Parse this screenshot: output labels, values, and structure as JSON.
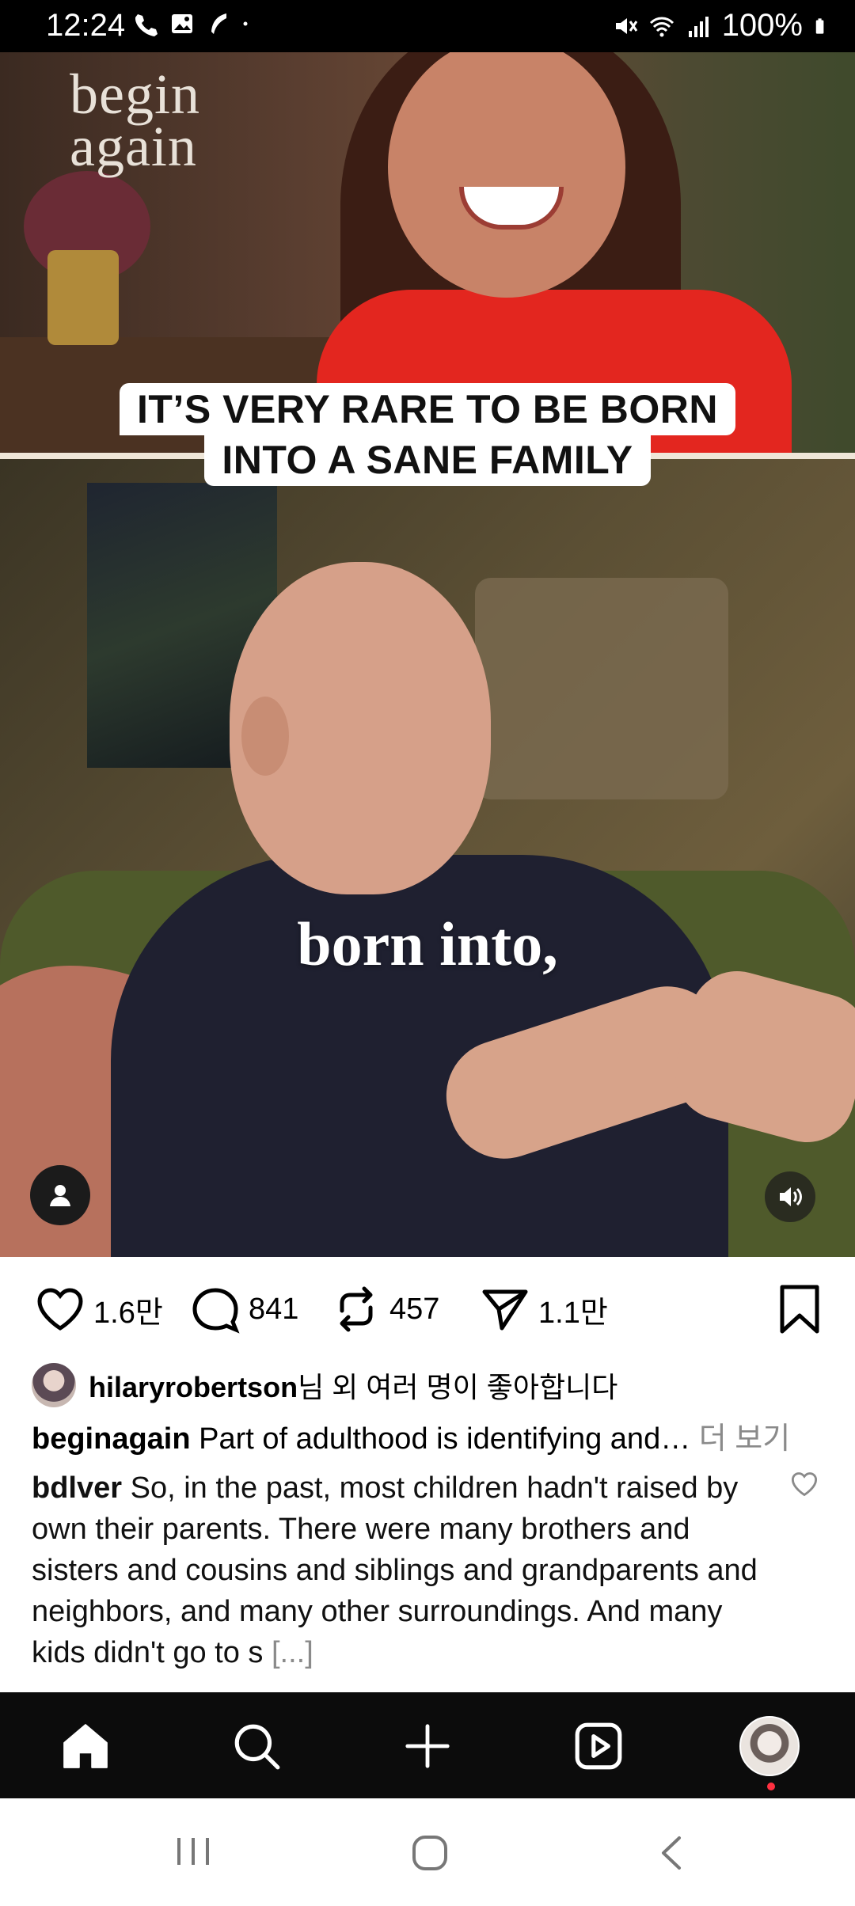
{
  "status_bar": {
    "time": "12:24",
    "battery": "100%",
    "left_icons": [
      "call-icon",
      "gallery-icon",
      "feather-icon",
      "dot-icon"
    ],
    "right_icons": [
      "mute-icon",
      "wifi-icon",
      "signal-icon",
      "battery-icon"
    ]
  },
  "post": {
    "logo_text": "begin again",
    "overlay_caption": {
      "line1": "IT’S VERY RARE TO BE BORN",
      "line2": "INTO A SANE FAMILY"
    },
    "subtitle": "born into,"
  },
  "actions": {
    "likes": "1.6만",
    "comments": "841",
    "reposts": "457",
    "shares": "1.1만"
  },
  "liked_by": {
    "username": "hilaryrobertson",
    "suffix": "님 외 여러 명이 좋아합니다"
  },
  "caption": {
    "username": "beginagain",
    "text": "Part of adulthood is identifying and…",
    "more": "더 보기"
  },
  "comment": {
    "username": "bdlver",
    "text": "So, in the past, most children hadn't raised by own their parents. There were many brothers and sisters and cousins and siblings and grandparents and neighbors, and many other surroundings. And many kids didn't go to s",
    "truncate": "[...]"
  },
  "bottom_nav": [
    "home-icon",
    "search-icon",
    "create-icon",
    "reels-icon",
    "profile-avatar"
  ],
  "system_nav": [
    "recents-icon",
    "home-circle-icon",
    "back-icon"
  ],
  "colors": {
    "notification_dot": "#ff3040",
    "nav_background": "#0c0c0c",
    "shirt_red": "#e3261f"
  }
}
